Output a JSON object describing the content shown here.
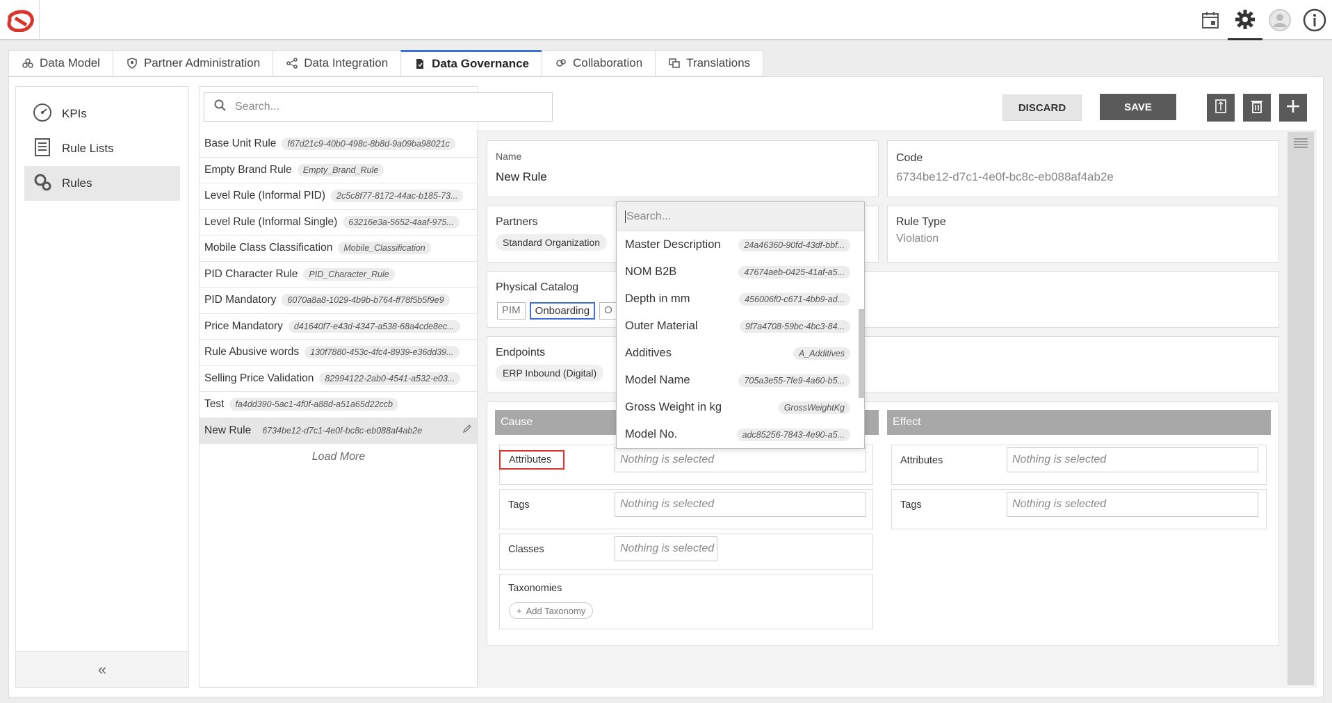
{
  "topbar": {
    "icons": [
      "calendar-icon",
      "gear-icon",
      "user-avatar-icon",
      "info-icon"
    ]
  },
  "tabs": [
    {
      "label": "Data Model",
      "icon": "data-model-icon"
    },
    {
      "label": "Partner Administration",
      "icon": "shield-icon"
    },
    {
      "label": "Data Integration",
      "icon": "integration-icon"
    },
    {
      "label": "Data Governance",
      "icon": "governance-icon",
      "active": true
    },
    {
      "label": "Collaboration",
      "icon": "collaboration-icon"
    },
    {
      "label": "Translations",
      "icon": "translations-icon"
    }
  ],
  "leftnav": {
    "items": [
      {
        "label": "KPIs",
        "icon": "gauge-icon"
      },
      {
        "label": "Rule Lists",
        "icon": "list-icon"
      },
      {
        "label": "Rules",
        "icon": "gears-icon",
        "active": true
      }
    ],
    "collapse": "«"
  },
  "search": {
    "placeholder": "Search..."
  },
  "rules": [
    {
      "name": "Base Unit Rule",
      "id": "f67d21c9-40b0-498c-8b8d-9a09ba98021c"
    },
    {
      "name": "Empty Brand Rule",
      "id": "Empty_Brand_Rule"
    },
    {
      "name": "Level Rule (Informal PID)",
      "id": "2c5c8f77-8172-44ac-b185-73..."
    },
    {
      "name": "Level Rule (Informal Single)",
      "id": "63216e3a-5652-4aaf-975..."
    },
    {
      "name": "Mobile Class Classification",
      "id": "Mobile_Classification"
    },
    {
      "name": "PID Character Rule",
      "id": "PID_Character_Rule"
    },
    {
      "name": "PID Mandatory",
      "id": "6070a8a8-1029-4b9b-b764-ff78f5b5f9e9"
    },
    {
      "name": "Price Mandatory",
      "id": "d41640f7-e43d-4347-a538-68a4cde8ec..."
    },
    {
      "name": "Rule Abusive words",
      "id": "130f7880-453c-4fc4-8939-e36dd39..."
    },
    {
      "name": "Selling Price Validation",
      "id": "82994122-2ab0-4541-a532-e03..."
    },
    {
      "name": "Test",
      "id": "fa4dd390-5ac1-4f0f-a88d-a51a65d22ccb"
    },
    {
      "name": "New Rule",
      "id": "6734be12-d7c1-4e0f-bc8c-eb088af4ab2e",
      "selected": true
    }
  ],
  "load_more": "Load More",
  "toolbar": {
    "discard": "DISCARD",
    "save": "SAVE"
  },
  "detail": {
    "name_label": "Name",
    "name_value": "New Rule",
    "code_label": "Code",
    "code_value": "6734be12-d7c1-4e0f-bc8c-eb088af4ab2e",
    "partners_label": "Partners",
    "partners_value": "Standard Organization",
    "rule_type_label": "Rule Type",
    "rule_type_value": "Violation",
    "catalog_label": "Physical Catalog",
    "catalog_tags": [
      "PIM",
      "Onboarding",
      "O"
    ],
    "endpoints_label": "Endpoints",
    "endpoints_value": "ERP Inbound (Digital)"
  },
  "cause": {
    "title": "Cause",
    "attributes_label": "Attributes",
    "tags_label": "Tags",
    "classes_label": "Classes",
    "taxonomies_label": "Taxonomies",
    "add_taxonomy": "Add Taxonomy",
    "nothing_selected": "Nothing is selected"
  },
  "effect": {
    "title": "Effect",
    "attributes_label": "Attributes",
    "tags_label": "Tags",
    "nothing_selected": "Nothing is selected"
  },
  "dropdown": {
    "search_placeholder": "Search...",
    "items": [
      {
        "name": "Master Description",
        "id": "24a46360-90fd-43df-bbf..."
      },
      {
        "name": "NOM B2B",
        "id": "47674aeb-0425-41af-a5..."
      },
      {
        "name": "Depth in mm",
        "id": "456006f0-c671-4bb9-ad..."
      },
      {
        "name": "Outer Material",
        "id": "9f7a4708-59bc-4bc3-84..."
      },
      {
        "name": "Additives",
        "id": "A_Additives"
      },
      {
        "name": "Model Name",
        "id": "705a3e55-7fe9-4a60-b5..."
      },
      {
        "name": "Gross Weight in kg",
        "id": "GrossWeightKg"
      },
      {
        "name": "Model No.",
        "id": "adc85256-7843-4e90-a5..."
      }
    ]
  },
  "colors": {
    "accent": "#3d6fd9",
    "highlight": "#d9342b",
    "section_header": "#a8a8a8",
    "dark_button": "#5a5a5a"
  }
}
